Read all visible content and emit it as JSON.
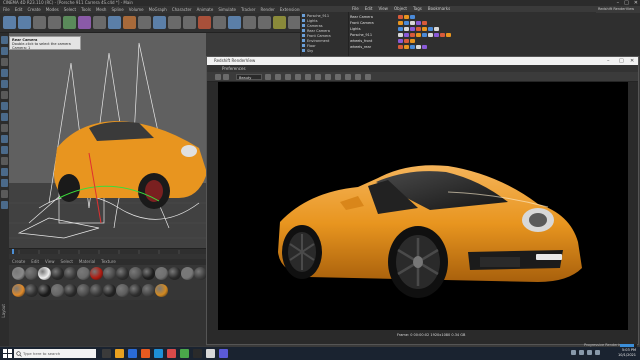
{
  "app": {
    "window_title": "CINEMA 4D R23.110 (RC) - [Porsche 911 Carrera 4S.c4d *] - Main"
  },
  "menubar": {
    "items": [
      "File",
      "Edit",
      "Create",
      "Modes",
      "Select",
      "Tools",
      "Mesh",
      "Spline",
      "Volume",
      "MoGraph",
      "Character",
      "Animate",
      "Simulate",
      "Tracker",
      "Render",
      "Extensions",
      "Redshift",
      "Window",
      "Help"
    ],
    "active_item": "Redshift"
  },
  "window_controls": {
    "minimize": "–",
    "maximize": "□",
    "close": "✕"
  },
  "viewport_tooltip": {
    "title": "Rear Camera",
    "line1": "Double-click to select the camera",
    "line2": "Camera: 1"
  },
  "material_manager": {
    "menu": [
      "Create",
      "Edit",
      "View",
      "Select",
      "Material",
      "Texture"
    ],
    "swatches": [
      [
        "#8a8a8a",
        "#5a5a5a",
        "#f0f0f0",
        "#2a2a2a",
        "#3a3a3a",
        "#6a6a6a",
        "#b01a10",
        "#4a4a4a",
        "#303030",
        "#555555",
        "#1e1e1e",
        "#707070",
        "#2a2a2a",
        "#777777",
        "#3d3d3d"
      ],
      [
        "#e08a2a",
        "#303030",
        "#1a1a1a",
        "#666666",
        "#2a2a2a",
        "#4c4c4c",
        "#383838",
        "#222222",
        "#5d5d5d",
        "#2e2e2e",
        "#444444",
        "#d48a20"
      ]
    ]
  },
  "object_manager": {
    "objects": [
      "Porsche_911",
      "Lights",
      "Cameras",
      "Rear Camera",
      "Front Camera",
      "Environment",
      "Floor",
      "Sky"
    ]
  },
  "scene_panel": {
    "menu": [
      "File",
      "Edit",
      "View",
      "Object",
      "Tags",
      "Bookmarks"
    ],
    "rows": [
      "Rear Camera",
      "Front Camera",
      "Lights",
      "Porsche_911",
      "wheels_front",
      "wheels_rear"
    ]
  },
  "render_settings_label": "Redshift RenderView",
  "render_view": {
    "title": "Redshift RenderView",
    "menu": "Preferences",
    "camera_select": "Beauty",
    "status_text": "Frame: 0   00:00:02   1920x1080   0.34 GB",
    "window_controls": {
      "minimize": "–",
      "maximize": "□",
      "close": "✕"
    }
  },
  "progress": {
    "label": "Progressive Rendering",
    "fraction": 0.82
  },
  "taskbar": {
    "search_placeholder": "Type here to search",
    "time": "5:03 PM",
    "date": "10/1/2021"
  },
  "colors": {
    "accent_orange": "#e8951f",
    "ui_dark": "#2f2f2f",
    "taskbar": "#1a2330",
    "progress_blue": "#3b8ed8"
  }
}
